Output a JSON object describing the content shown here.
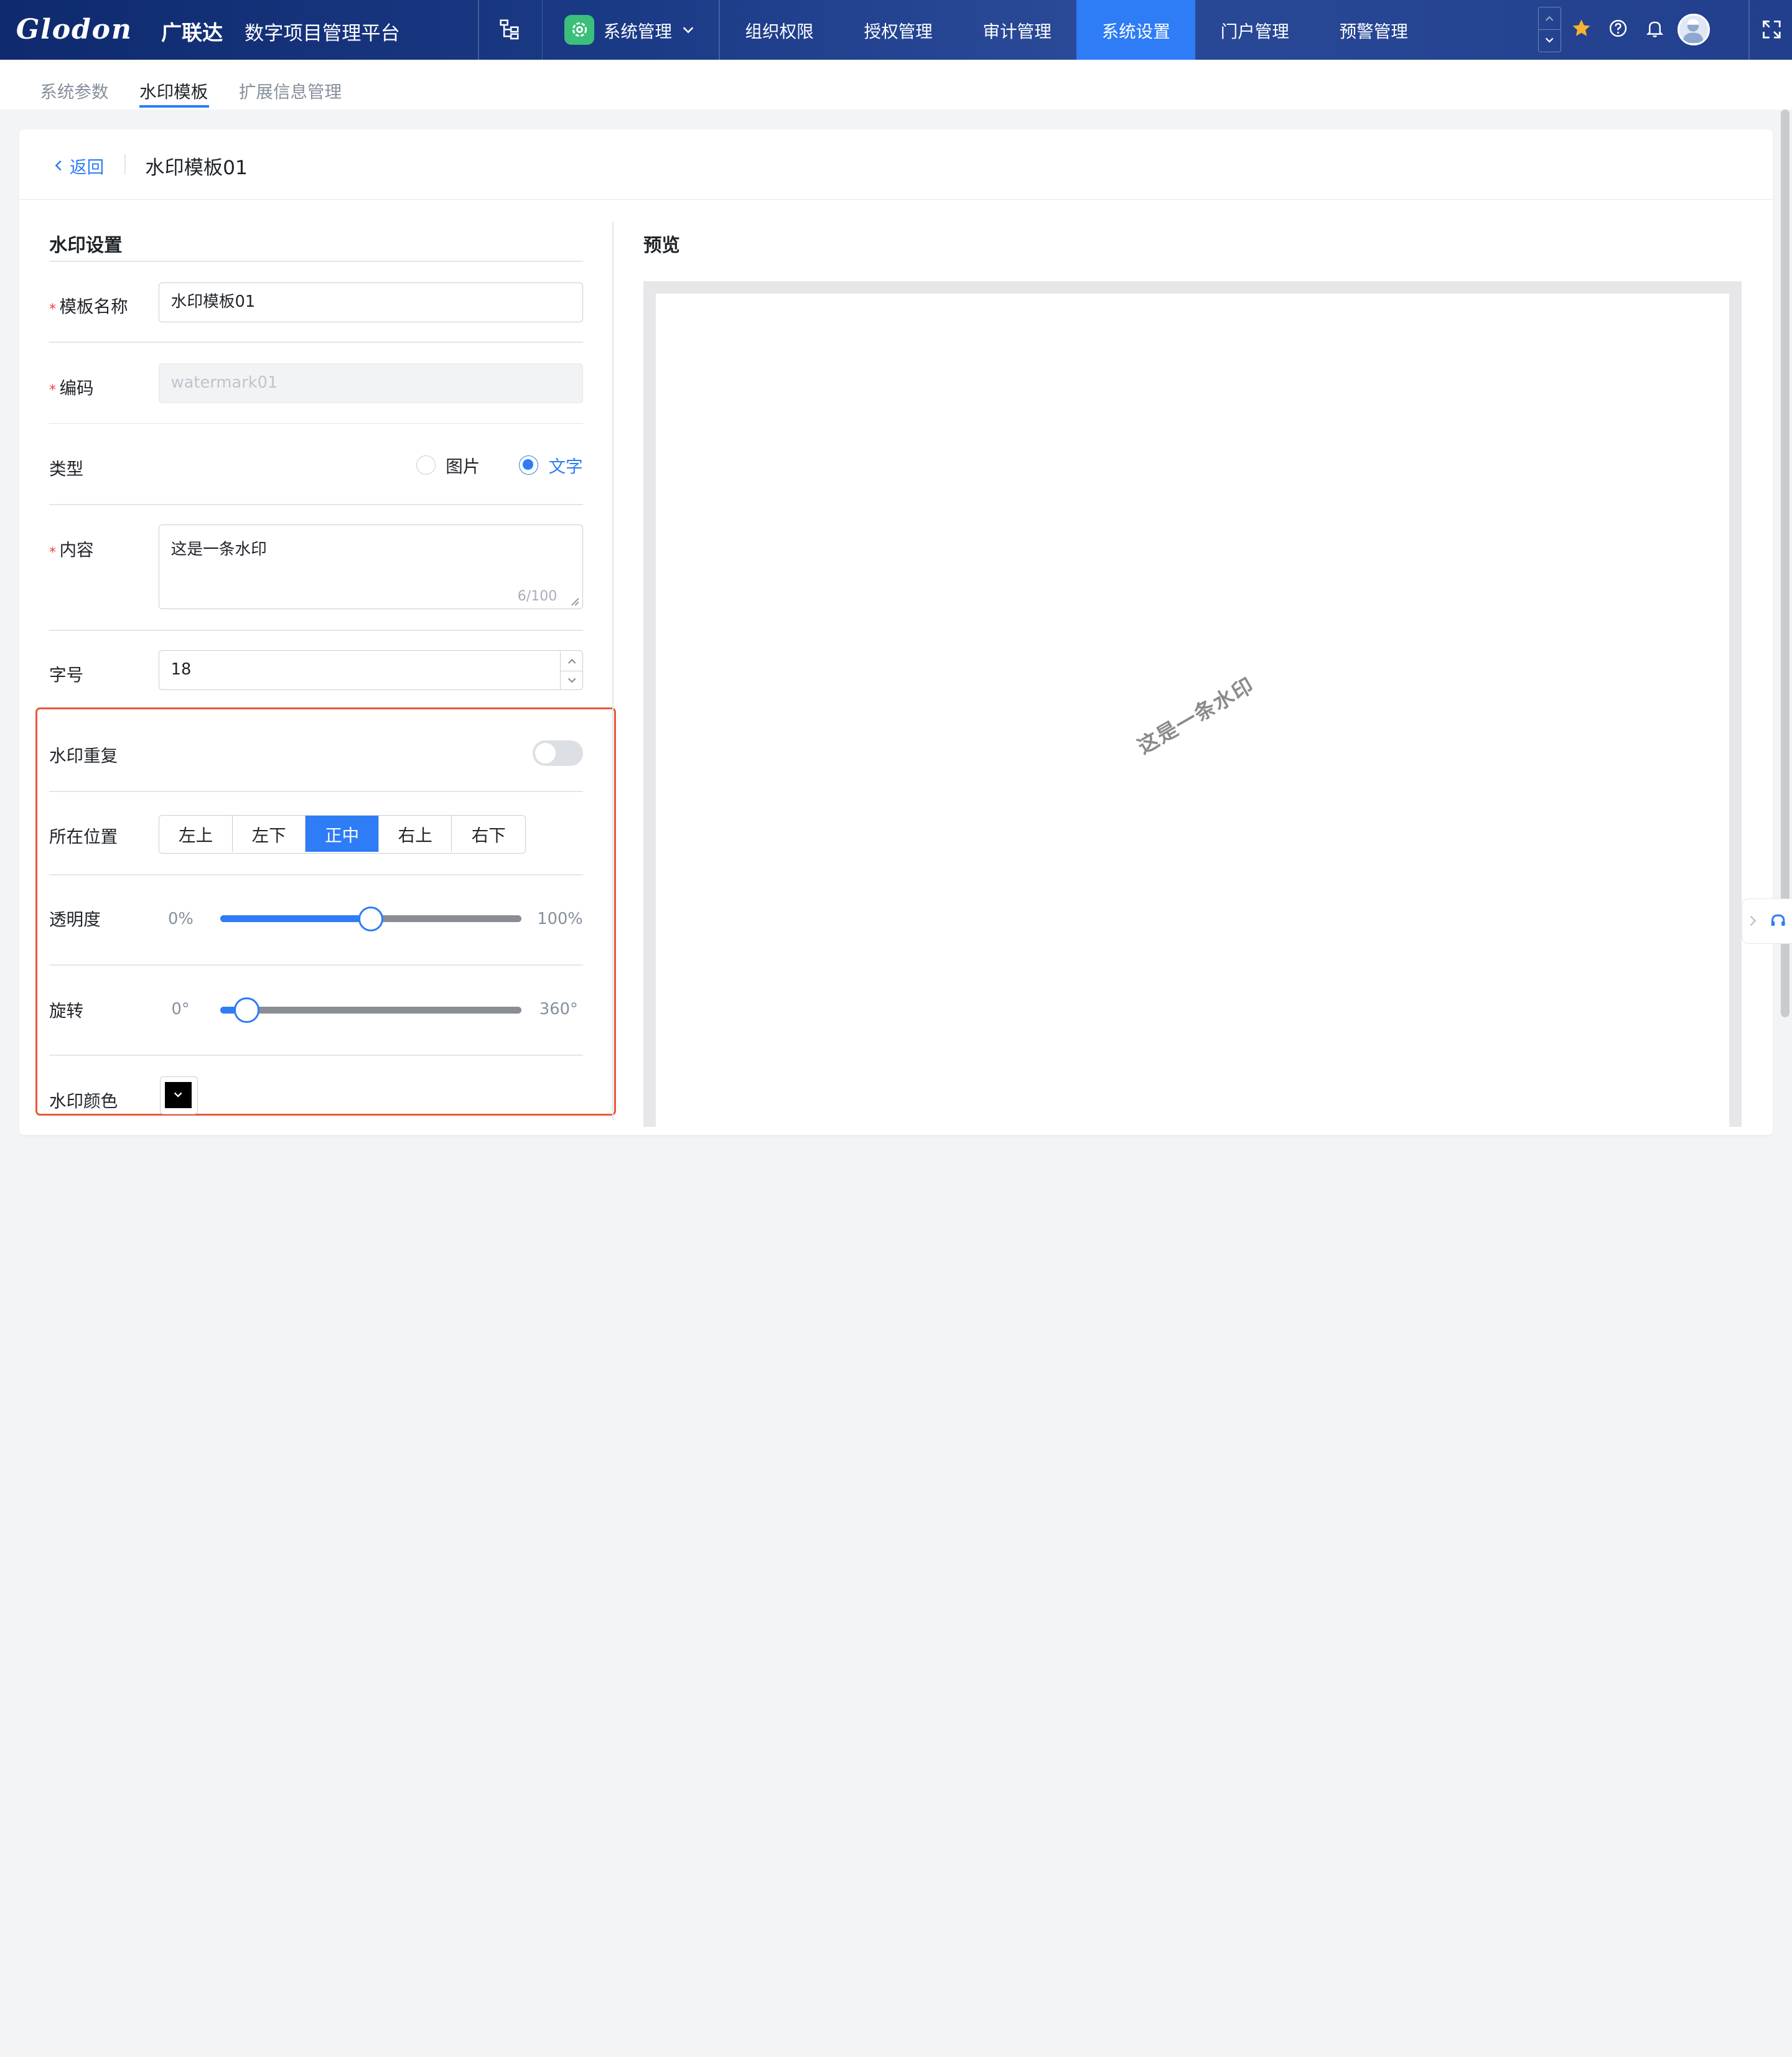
{
  "header": {
    "logo_text": "Glodon",
    "logo_cn": "广联达",
    "platform_name": "数字项目管理平台",
    "app_switcher_label": "系统管理",
    "nav": [
      "组织权限",
      "授权管理",
      "审计管理",
      "系统设置",
      "门户管理",
      "预警管理"
    ],
    "nav_active": "系统设置",
    "icons": [
      "org-tree-icon",
      "gear-icon",
      "chevron-down-icon",
      "star-icon",
      "help-icon",
      "bell-icon",
      "user-avatar",
      "fullscreen-icon"
    ]
  },
  "subtabs": [
    "系统参数",
    "水印模板",
    "扩展信息管理"
  ],
  "subtab_active": "水印模板",
  "page": {
    "back_label": "返回",
    "title": "水印模板01"
  },
  "settings": {
    "section_title": "水印设置",
    "template_name_label": "模板名称",
    "template_name_value": "水印模板01",
    "code_label": "编码",
    "code_value": "watermark01",
    "type_label": "类型",
    "type_options": [
      "图片",
      "文字"
    ],
    "type_selected": "文字",
    "content_label": "内容",
    "content_value": "这是一条水印",
    "content_count": "6/100",
    "font_size_label": "字号",
    "font_size_value": "18",
    "repeat_label": "水印重复",
    "repeat_enabled": false,
    "position_label": "所在位置",
    "position_options": [
      "左上",
      "左下",
      "正中",
      "右上",
      "右下"
    ],
    "position_selected": "正中",
    "opacity_label": "透明度",
    "opacity_min": "0%",
    "opacity_max": "100%",
    "opacity_value_percent": 50,
    "rotation_label": "旋转",
    "rotation_min": "0°",
    "rotation_max": "360°",
    "rotation_value_deg": 30,
    "color_label": "水印颜色",
    "color_value": "#000000"
  },
  "preview": {
    "section_title": "预览",
    "watermark_text": "这是一条水印"
  },
  "colors": {
    "primary": "#2e7cf6",
    "header_bg": "#1b3a86",
    "required": "#f53f3f",
    "highlight_border": "#e8593a"
  }
}
